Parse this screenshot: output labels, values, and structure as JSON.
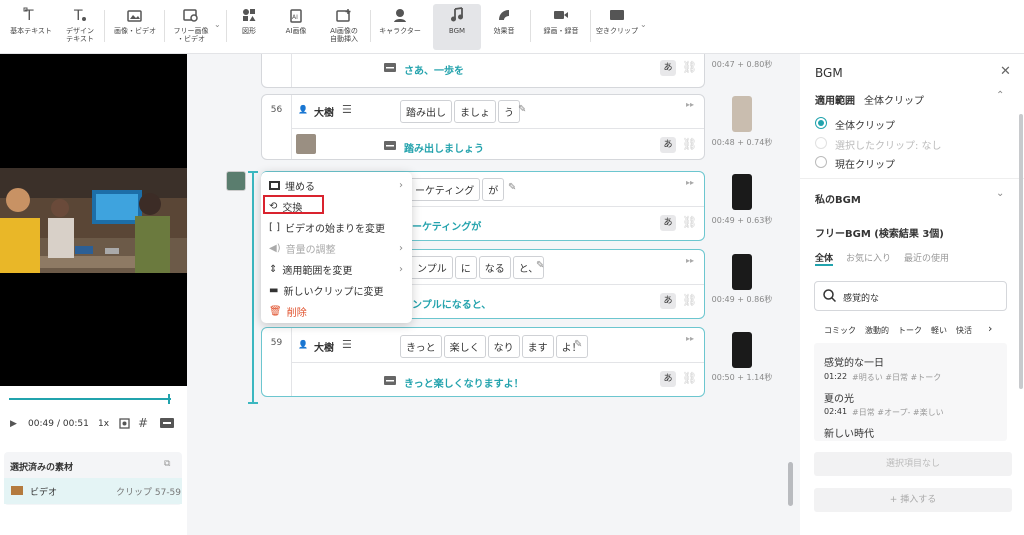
{
  "toolbar": {
    "items": [
      {
        "label": "基本テキスト",
        "icon": "text-t-icon"
      },
      {
        "label": "デザイン\nテキスト",
        "icon": "design-text-icon"
      },
      {
        "label": "画像・ビデオ",
        "icon": "image-video-icon"
      },
      {
        "label": "フリー画像\n・ビデオ",
        "icon": "free-image-icon"
      },
      {
        "label": "図形",
        "icon": "shape-icon"
      },
      {
        "label": "AI画像",
        "icon": "ai-image-icon"
      },
      {
        "label": "AI画像の\n自動挿入",
        "icon": "ai-insert-icon"
      },
      {
        "label": "キャラクター",
        "icon": "character-icon"
      },
      {
        "label": "BGM",
        "icon": "music-note-icon"
      },
      {
        "label": "効果音",
        "icon": "sound-effect-icon"
      },
      {
        "label": "録画・録音",
        "icon": "record-icon"
      },
      {
        "label": "空きクリップ",
        "icon": "empty-clip-icon"
      }
    ]
  },
  "player": {
    "current": "00:49",
    "total": "/ 00:51",
    "speed": "1x",
    "progress": 0.96
  },
  "selected_material": {
    "title": "選択済みの素材",
    "item_label": "ビデオ",
    "item_range": "クリップ 57-59"
  },
  "clips": {
    "top": {
      "caption": "さあ、一歩を",
      "time": "00:47 + 0.80秒"
    },
    "c56": {
      "num": "56",
      "speaker": "大樹",
      "words": [
        "踏み出し",
        "ましょ",
        "う"
      ],
      "caption": "踏み出しましょう",
      "time": "00:48 + 0.74秒"
    },
    "c57": {
      "words": [
        "ーケティング",
        "が"
      ],
      "caption": "ーケティングが",
      "time": "00:49 + 0.63秒"
    },
    "c58": {
      "words": [
        "ンプル",
        "に",
        "なる",
        "と、"
      ],
      "caption": "ンプルになると、",
      "time": "00:49 + 0.86秒"
    },
    "c59": {
      "num": "59",
      "speaker": "大樹",
      "words": [
        "きっと",
        "楽しく",
        "なり",
        "ます",
        "よ！"
      ],
      "caption": "きっと楽しくなりますよ！",
      "time": "00:50 + 1.14秒"
    },
    "a_label": "あ"
  },
  "context_menu": {
    "items": [
      "埋める",
      "交換",
      "ビデオの始まりを変更",
      "音量の調整",
      "適用範囲を変更",
      "新しいクリップに変更",
      "削除"
    ]
  },
  "bgm_panel": {
    "title": "BGM",
    "scope_label": "適用範囲",
    "scope_value": "全体クリップ",
    "radio": [
      "全体クリップ",
      "選択したクリップ: なし",
      "現在クリップ"
    ],
    "my_bgm": "私のBGM",
    "free_bgm": "フリーBGM (検索結果 3個)",
    "tabs": [
      "全体",
      "お気に入り",
      "最近の使用"
    ],
    "search_value": "感覚的な",
    "categories": [
      "コミック",
      "激動的",
      "トーク",
      "軽い",
      "快活"
    ],
    "tracks": [
      {
        "title": "感覚的な一日",
        "duration": "01:22",
        "tags": [
          "#明るい",
          "#日常",
          "#トーク"
        ]
      },
      {
        "title": "夏の光",
        "duration": "02:41",
        "tags": [
          "#日常",
          "#オープ-",
          "#楽しい"
        ]
      },
      {
        "title": "新しい時代",
        "duration": "",
        "tags": []
      }
    ],
    "no_selection": "選択項目なし",
    "insert_label": "+ 挿入する"
  },
  "colors": {
    "accent": "#21a3ad",
    "delete": "#e0502b",
    "highlight_box": "#d9232e"
  }
}
